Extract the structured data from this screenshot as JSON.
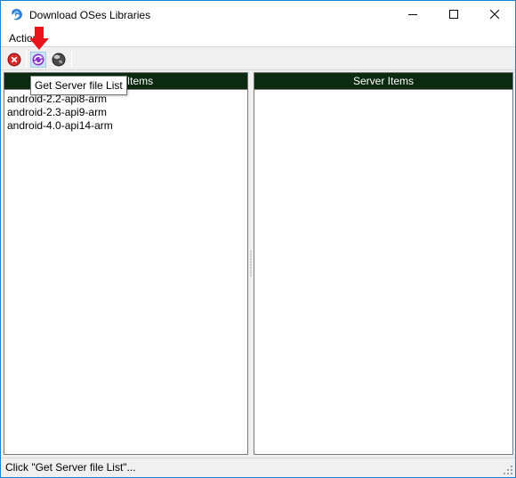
{
  "window": {
    "title": "Download OSes Libraries",
    "controls": [
      "minimize-icon",
      "maximize-icon",
      "close-icon"
    ]
  },
  "menu": {
    "items": [
      {
        "label": "Action"
      }
    ]
  },
  "toolbar": {
    "buttons": [
      {
        "icon": "stop-icon",
        "color": "#d42a2a"
      },
      {
        "icon": "refresh-icon",
        "color": "#8a35c8"
      },
      {
        "icon": "globe-icon",
        "color": "#3a3a3a"
      }
    ]
  },
  "tooltip": {
    "text": "Get Server file List"
  },
  "local_panel": {
    "header": "Local Items",
    "items": [
      "android-2.2-api8-arm",
      "android-2.3-api9-arm",
      "android-4.0-api14-arm"
    ]
  },
  "server_panel": {
    "header": "Server Items",
    "items": []
  },
  "statusbar": {
    "text": "Click \"Get Server file List\"..."
  },
  "colors": {
    "header_bg": "#0b2a10",
    "window_border": "#1883d7",
    "pointer_arrow": "#e8141c"
  }
}
